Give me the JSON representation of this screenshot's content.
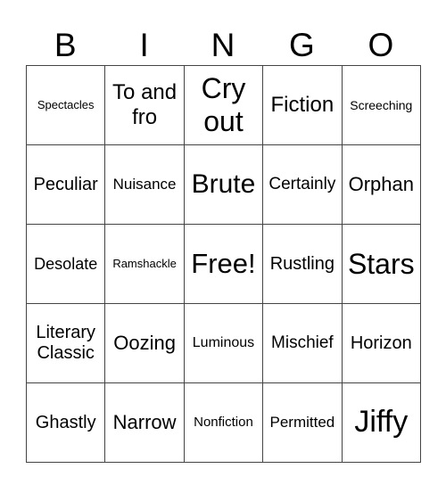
{
  "header": [
    "B",
    "I",
    "N",
    "G",
    "O"
  ],
  "cells": [
    [
      {
        "text": "Spectacles",
        "size": 13
      },
      {
        "text": "To and fro",
        "size": 24
      },
      {
        "text": "Cry out",
        "size": 32
      },
      {
        "text": "Fiction",
        "size": 24
      },
      {
        "text": "Screeching",
        "size": 14
      }
    ],
    [
      {
        "text": "Peculiar",
        "size": 20
      },
      {
        "text": "Nuisance",
        "size": 17
      },
      {
        "text": "Brute",
        "size": 30
      },
      {
        "text": "Certainly",
        "size": 19
      },
      {
        "text": "Orphan",
        "size": 22
      }
    ],
    [
      {
        "text": "Desolate",
        "size": 18
      },
      {
        "text": "Ramshackle",
        "size": 13
      },
      {
        "text": "Free!",
        "size": 31
      },
      {
        "text": "Rustling",
        "size": 20
      },
      {
        "text": "Stars",
        "size": 32
      }
    ],
    [
      {
        "text": "Literary Classic",
        "size": 20
      },
      {
        "text": "Oozing",
        "size": 22
      },
      {
        "text": "Luminous",
        "size": 16
      },
      {
        "text": "Mischief",
        "size": 19
      },
      {
        "text": "Horizon",
        "size": 20
      }
    ],
    [
      {
        "text": "Ghastly",
        "size": 20
      },
      {
        "text": "Narrow",
        "size": 22
      },
      {
        "text": "Nonfiction",
        "size": 15
      },
      {
        "text": "Permitted",
        "size": 17
      },
      {
        "text": "Jiffy",
        "size": 34
      }
    ]
  ]
}
